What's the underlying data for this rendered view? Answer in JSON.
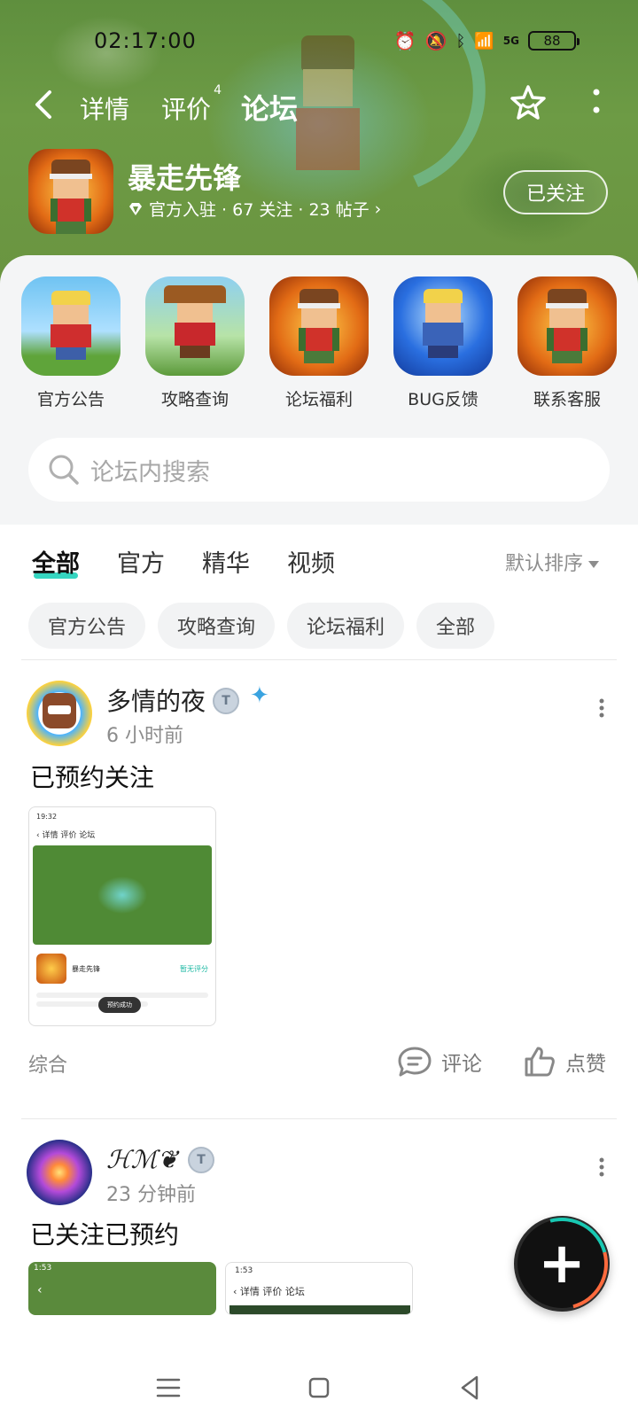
{
  "status_bar": {
    "time": "02:17:00",
    "battery": "88",
    "network": "5G"
  },
  "nav": {
    "back": "‹",
    "tabs": [
      "详情",
      "评价",
      "论坛"
    ],
    "review_count": "4",
    "active_tab": "论坛"
  },
  "game": {
    "name": "暴走先锋",
    "meta": "官方入驻 · 67 关注 · 23 帖子",
    "follow_label": "已关注"
  },
  "quick_links": [
    {
      "label": "官方公告"
    },
    {
      "label": "攻略查询"
    },
    {
      "label": "论坛福利"
    },
    {
      "label": "BUG反馈"
    },
    {
      "label": "联系客服"
    }
  ],
  "search": {
    "placeholder": "论坛内搜索"
  },
  "filter_tabs": [
    "全部",
    "官方",
    "精华",
    "视频"
  ],
  "sort_label": "默认排序",
  "chips": [
    "官方公告",
    "攻略查询",
    "论坛福利",
    "全部"
  ],
  "posts": [
    {
      "username": "多情的夜",
      "time": "6 小时前",
      "title": "已预约关注",
      "category": "综合",
      "comment_label": "评论",
      "like_label": "点赞",
      "shot": {
        "time": "19:32",
        "tabs": "详情  评价  论坛",
        "game_name": "暴走先锋",
        "badge": "预约成功",
        "rate": "暂无评分"
      }
    },
    {
      "username": "ℋℳ❦",
      "time": "23 分钟前",
      "title": "已关注已预约",
      "shots": [
        {
          "time": "1:53"
        },
        {
          "time": "1:53",
          "tabs": "详情  评价  论坛"
        }
      ]
    }
  ],
  "colors": {
    "accent": "#1fd0b9",
    "hero_green": "#6a9440"
  }
}
